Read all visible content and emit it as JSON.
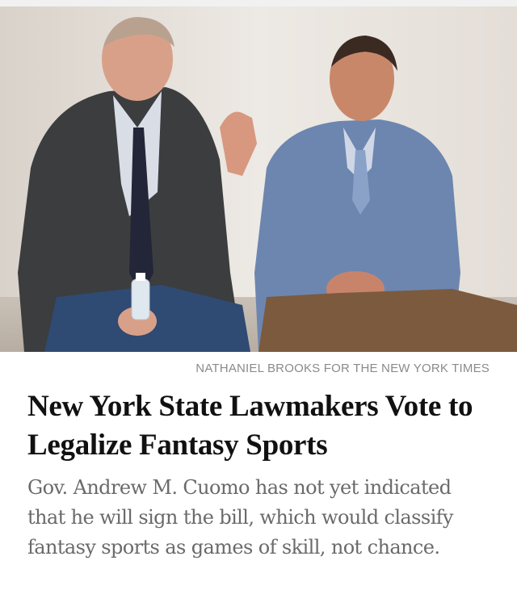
{
  "article": {
    "photo": {
      "icon": "news-photo",
      "credit": "NATHANIEL BROOKS FOR THE NEW YORK TIMES"
    },
    "headline": "New York State Lawmakers Vote to Legalize Fantasy Sports",
    "summary": "Gov. Andrew M. Cuomo has not yet indicated that he will sign the bill, which would classify fantasy sports as games of skill, not chance."
  },
  "colors": {
    "headline": "#111111",
    "summary": "#6a6a6a",
    "credit": "#8a8a8a",
    "background": "#ffffff"
  }
}
